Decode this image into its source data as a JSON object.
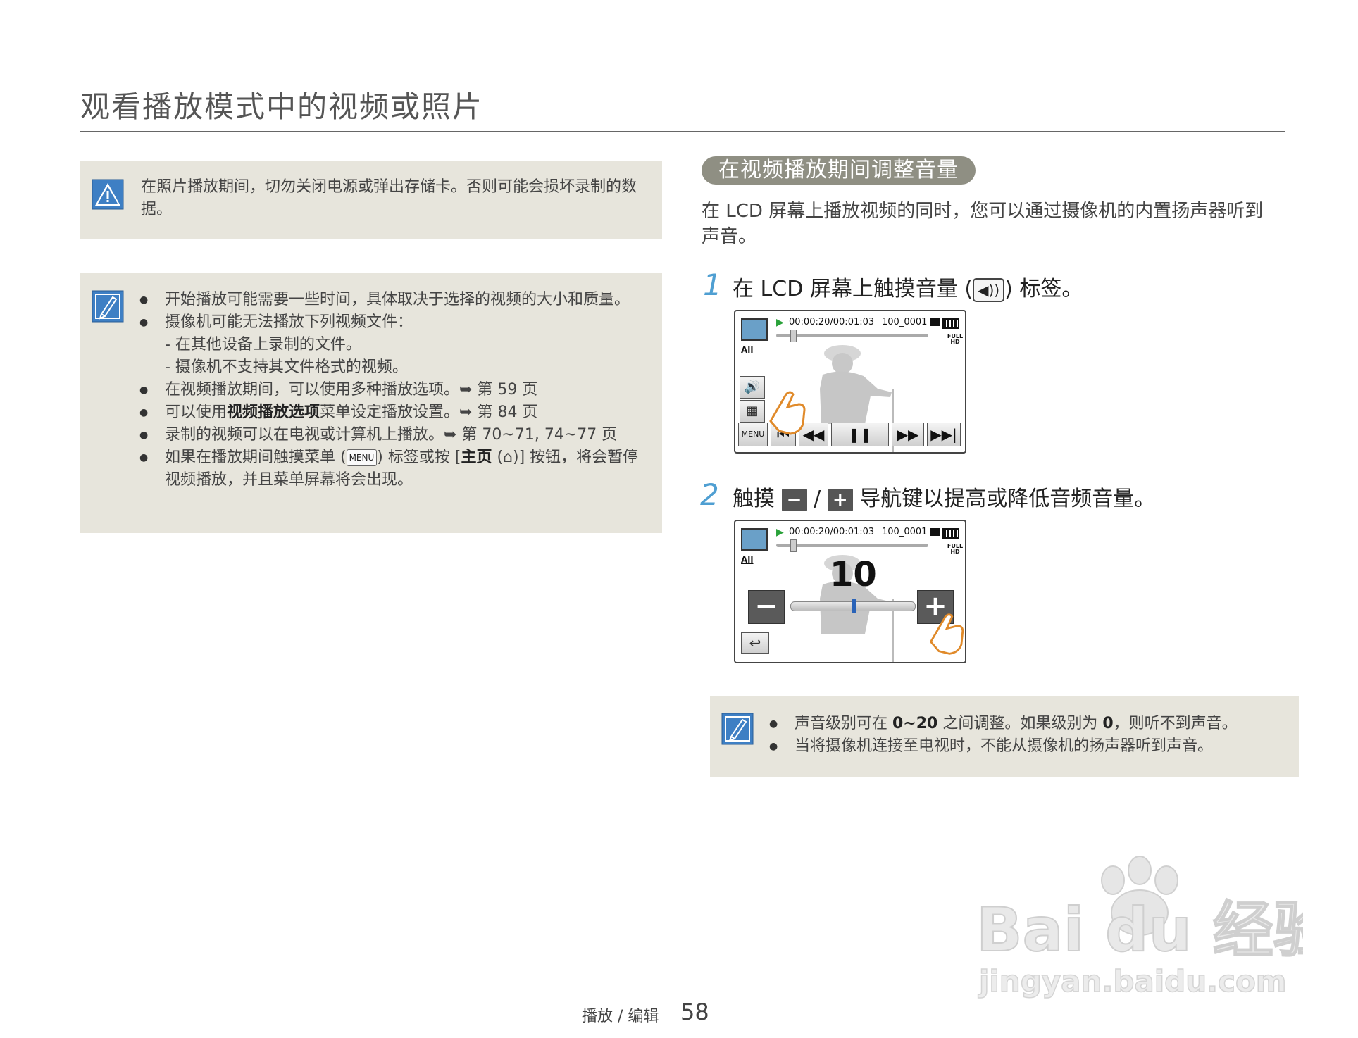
{
  "page_title": "观看播放模式中的视频或照片",
  "warning": {
    "text": "在照片播放期间，切勿关闭电源或弹出存储卡。否则可能会损坏录制的数据。"
  },
  "notes": {
    "items": [
      {
        "text": "开始播放可能需要一些时间，具体取决于选择的视频的大小和质量。"
      },
      {
        "text": "摄像机可能无法播放下列视频文件："
      },
      {
        "sub": "- 在其他设备上录制的文件。"
      },
      {
        "sub": "- 摄像机不支持其文件格式的视频。"
      },
      {
        "text": "在视频播放期间，可以使用多种播放选项。➥ 第 59 页"
      }
    ],
    "item6_pre": "可以使用",
    "item6_bold": "视频播放选项",
    "item6_post": "菜单设定播放设置。➥ 第 84 页",
    "item7": "录制的视频可以在电视或计算机上播放。➥ 第 70~71, 74~77 页",
    "item8_pre": "如果在播放期间触摸菜单 (",
    "item8_menu": "MENU",
    "item8_mid": ") 标签或按 [",
    "item8_bold": "主页",
    "item8_post": " (⌂)] 按钮，将会暂停视频播放，并且菜单屏幕将会出现。"
  },
  "section": {
    "title": "在视频播放期间调整音量",
    "intro": "在 LCD 屏幕上播放视频的同时，您可以通过摄像机的内置扬声器听到声音。"
  },
  "step1": {
    "num": "1",
    "pre": "在 LCD 屏幕上触摸音量 (",
    "tag": "◀))",
    "post": ") 标签。"
  },
  "step2": {
    "num": "2",
    "pre": "触摸 ",
    "minus": "−",
    "slash": "/",
    "plus": "+",
    "post": " 导航键以提高或降低音频音量。"
  },
  "lcd": {
    "time": "00:00:20/00:01:03",
    "file": "100_0001",
    "all": "All",
    "fullhd": "FULL HD",
    "menu": "MENU",
    "volume_value": "10",
    "volume_level": 0.5
  },
  "note2": {
    "l1_pre": "声音级别可在 ",
    "l1_b1": "0~20",
    "l1_mid": " 之间调整。如果级别为 ",
    "l1_b2": "0",
    "l1_post": "，则听不到声音。",
    "l2": "当将摄像机连接至电视时，不能从摄像机的扬声器听到声音。"
  },
  "footer": {
    "label": "播放 / 编辑",
    "page": "58"
  },
  "watermark": {
    "brand": "Bai du 经验",
    "url": "jingyan.baidu.com"
  },
  "colors": {
    "box_bg": "#e7e5dc",
    "pill_bg": "#8f8f83",
    "step_num": "#4f9fd2",
    "icon_blue": "#3e7fc4"
  }
}
